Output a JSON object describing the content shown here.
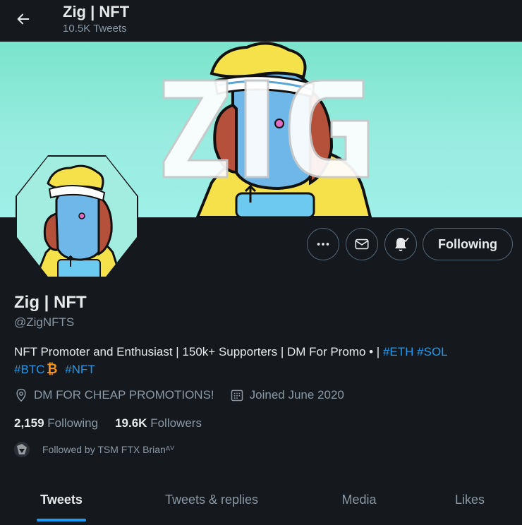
{
  "header": {
    "name": "Zig | NFT",
    "tweet_count": "10.5K Tweets",
    "back_icon": "arrow-left-icon"
  },
  "banner": {
    "background": "#7ae4cc",
    "logo_text": "ZIG"
  },
  "profile": {
    "display_name": "Zig | NFT",
    "handle": "@ZigNFTS",
    "bio_text": "NFT Promoter and Enthusiast | 150k+ Supporters | DM For Promo • | ",
    "bio_tags_line1": [
      "#ETH",
      "#SOL"
    ],
    "bio_tags_line2": [
      "#BTC",
      "#NFT"
    ],
    "location": "DM FOR CHEAP PROMOTIONS!",
    "joined": "Joined June 2020",
    "following_count": "2,159",
    "following_label": "Following",
    "followers_count": "19.6K",
    "followers_label": "Followers",
    "followed_by": "Followed by TSM FTX Brianᴬⱽ"
  },
  "actions": {
    "more_icon": "more-icon",
    "message_icon": "mail-icon",
    "notify_icon": "bell-icon",
    "follow_label": "Following"
  },
  "tabs": [
    {
      "label": "Tweets",
      "active": true
    },
    {
      "label": "Tweets & replies",
      "active": false
    },
    {
      "label": "Media",
      "active": false
    },
    {
      "label": "Likes",
      "active": false
    }
  ],
  "colors": {
    "background": "#15181c",
    "accent": "#1d9bf0",
    "text_primary": "#e7e9ea",
    "text_secondary": "#8b98a5",
    "bitcoin": "#f7931a"
  }
}
